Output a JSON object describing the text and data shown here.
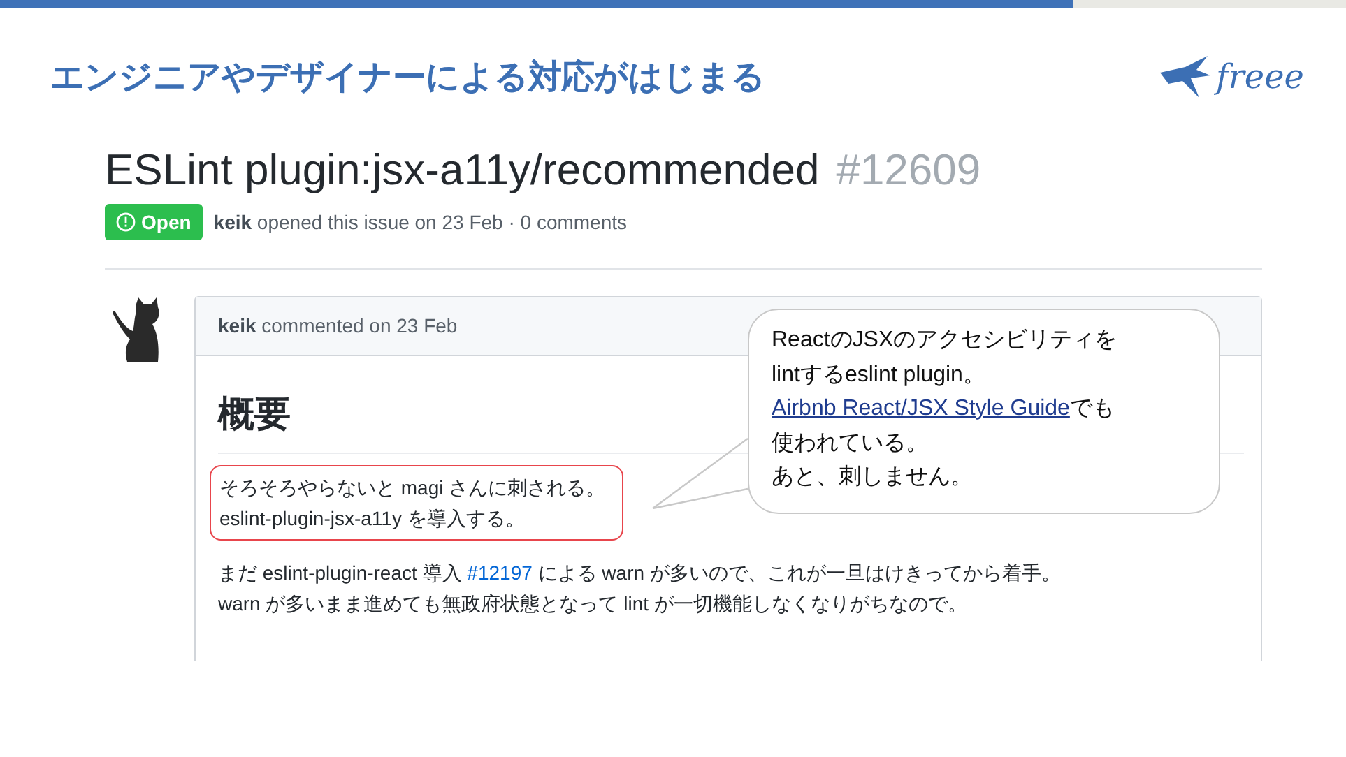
{
  "slide": {
    "title": "エンジニアやデザイナーによる対応がはじまる",
    "logo_text": "freee"
  },
  "issue": {
    "title": "ESLint plugin:jsx-a11y/recommended",
    "number": "#12609",
    "state": {
      "kind": "open",
      "label": "Open"
    },
    "meta": "**keik** opened this issue on 23 Feb · 0 comments"
  },
  "comment": {
    "header": "**keik** commented on 23 Feb",
    "heading": "概要",
    "highlight_lines": [
      "そろそろやらないと magi さんに刺される。",
      "eslint-plugin-jsx-a11y を導入する。"
    ],
    "paragraph_lines": [
      [
        {
          "text": "まだ eslint-plugin-react 導入 ",
          "link": false
        },
        {
          "text": "#12197",
          "link": true
        },
        {
          "text": " による warn が多いので、これが一旦はけきってから着手。",
          "link": false
        }
      ],
      [
        {
          "text": "warn が多いまま進めても無政府状態となって lint が一切機能しなくなりがちなので。",
          "link": false
        }
      ]
    ]
  },
  "callout": {
    "lines": [
      [
        {
          "text": "ReactのJSXのアクセシビリティを",
          "link": false
        }
      ],
      [
        {
          "text": "lintするeslint plugin。",
          "link": false
        }
      ],
      [
        {
          "text": "Airbnb React/JSX Style Guide",
          "link": true
        },
        {
          "text": "でも",
          "link": false
        }
      ],
      [
        {
          "text": "使われている。",
          "link": false
        }
      ],
      [
        {
          "text": "あと、刺しません。",
          "link": false
        }
      ]
    ]
  }
}
